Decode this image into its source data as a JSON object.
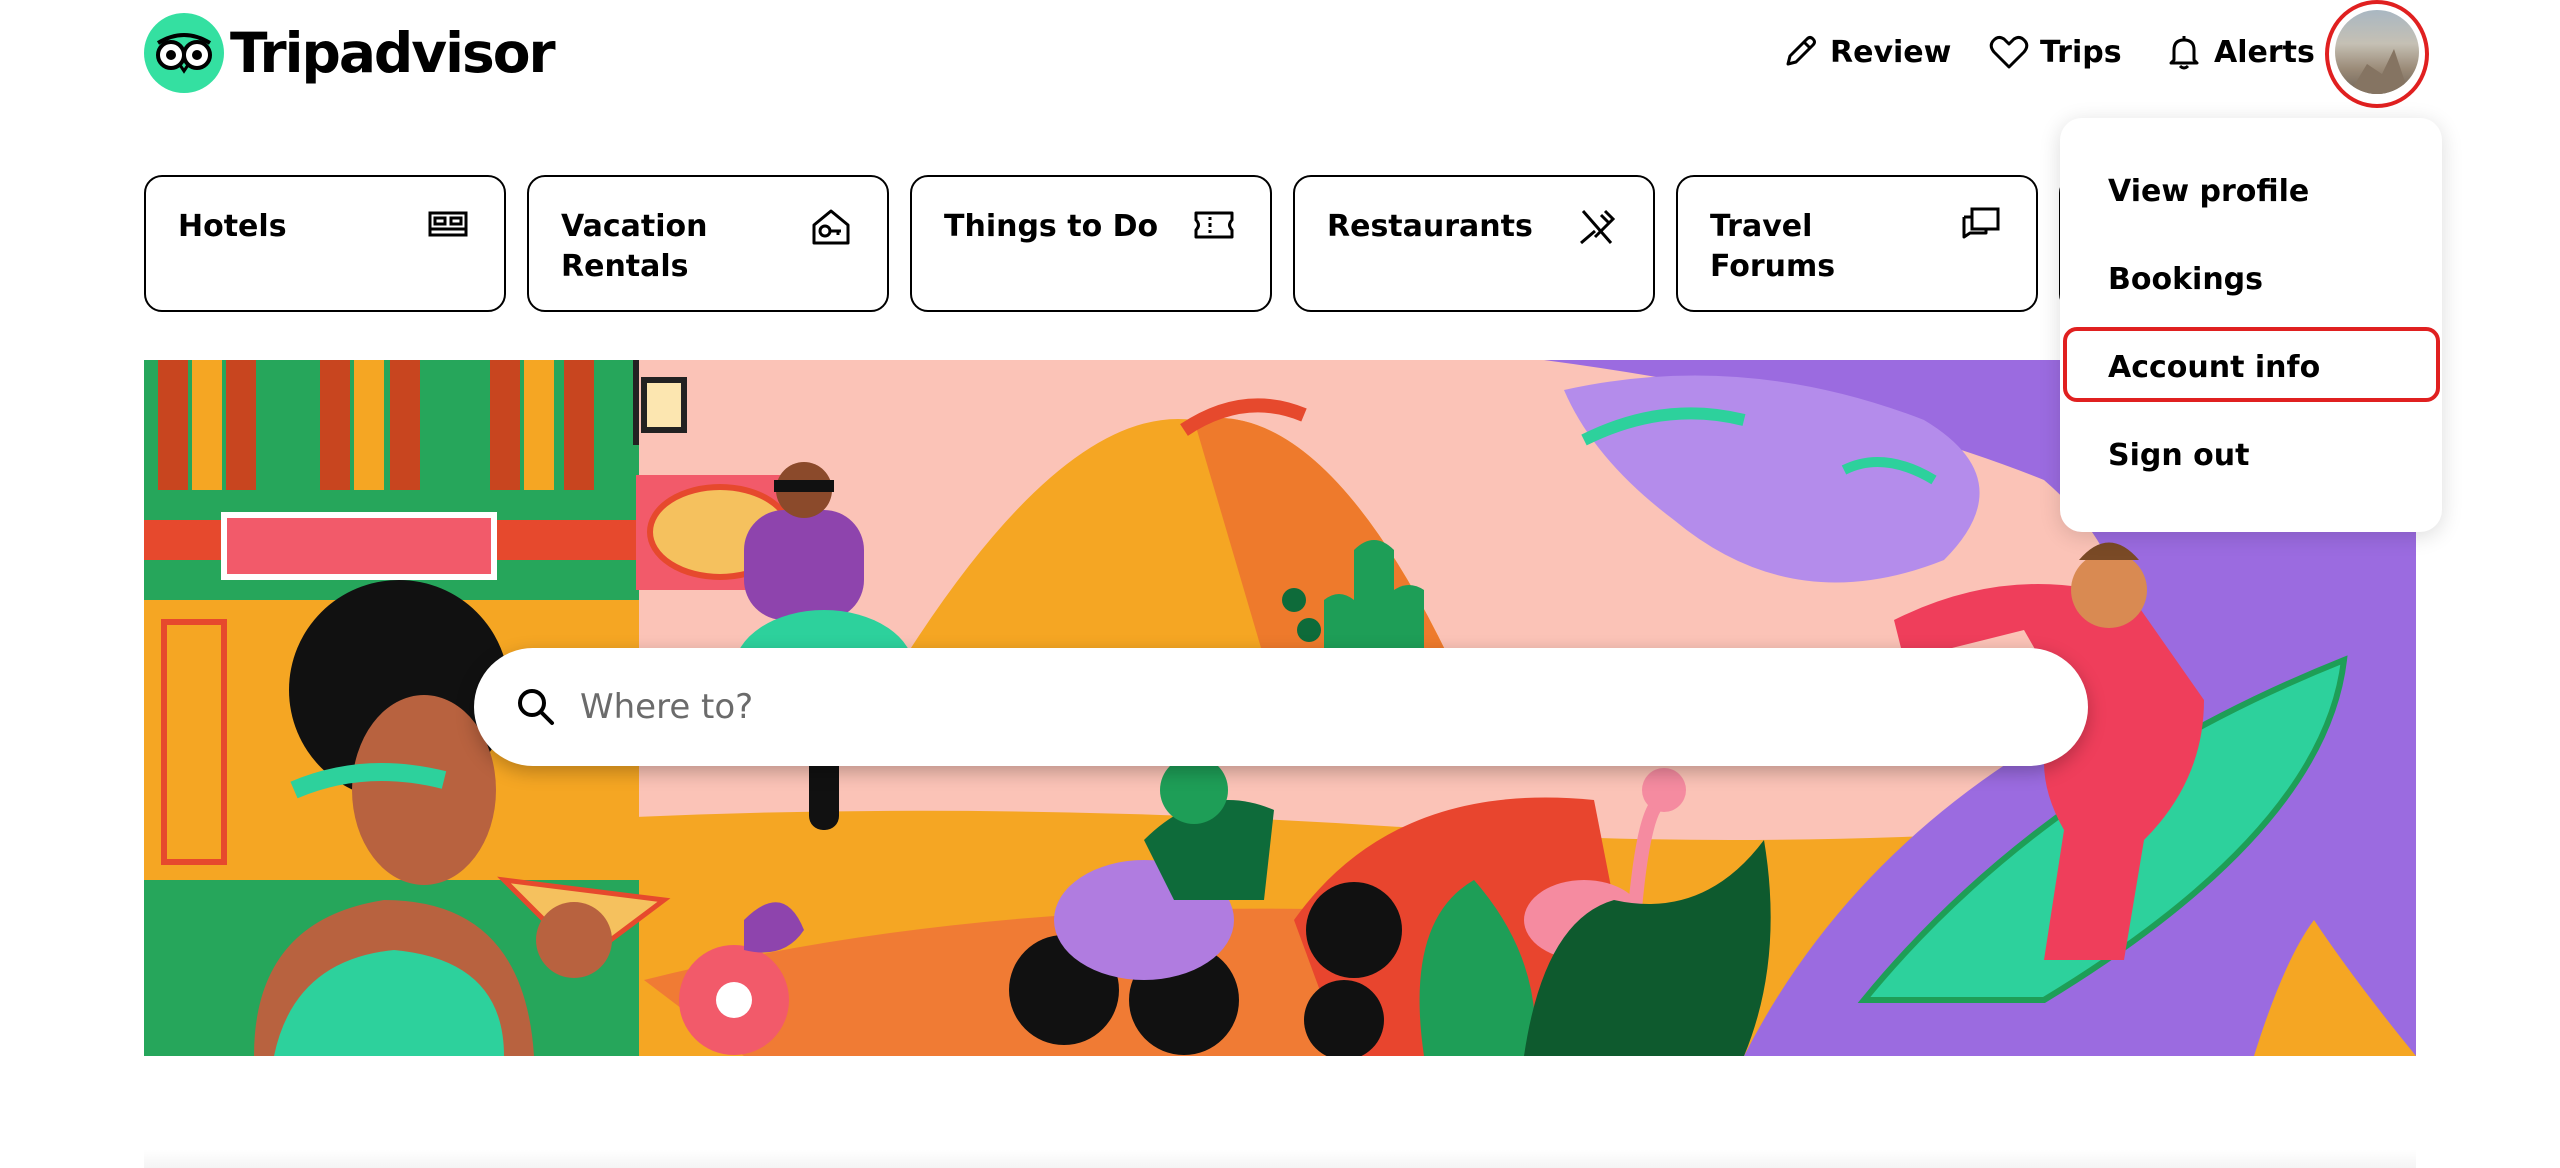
{
  "brand": {
    "name": "Tripadvisor",
    "accent": "#34E0A1"
  },
  "nav": {
    "review": "Review",
    "trips": "Trips",
    "alerts": "Alerts"
  },
  "tabs": [
    {
      "label": "Hotels",
      "icon": "bed-icon"
    },
    {
      "label": "Vacation Rentals",
      "icon": "house-key-icon"
    },
    {
      "label": "Things to Do",
      "icon": "ticket-icon"
    },
    {
      "label": "Restaurants",
      "icon": "fork-knife-icon"
    },
    {
      "label": "Travel Forums",
      "icon": "chat-bubbles-icon"
    }
  ],
  "search": {
    "placeholder": "Where to?"
  },
  "menu": {
    "items": [
      {
        "label": "View profile"
      },
      {
        "label": "Bookings"
      },
      {
        "label": "Account info"
      },
      {
        "label": "Sign out"
      }
    ],
    "highlighted": "Account info"
  },
  "highlight_color": "#E02020"
}
